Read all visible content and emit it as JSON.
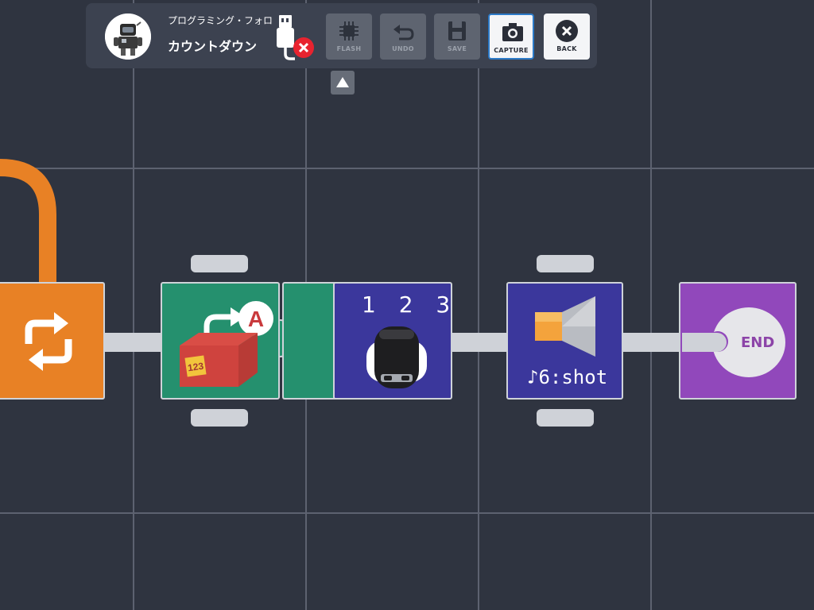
{
  "toolbar": {
    "subtitle": "プログラミング・フォロ",
    "title": "カウントダウン",
    "buttons": {
      "flash": "FLASH",
      "undo": "UNDO",
      "save": "SAVE",
      "capture": "CAPTURE",
      "back": "BACK"
    }
  },
  "blocks": {
    "number_display": {
      "label": "1 2 3"
    },
    "sound": {
      "label": "♪6:shot"
    },
    "end": {
      "label": "END"
    }
  },
  "colors": {
    "background": "#2f3440",
    "loop_block": "#e88125",
    "variable_block": "#25906e",
    "display_block": "#3b379c",
    "end_block": "#9148bb",
    "usb_error": "#e8232f",
    "selected_border": "#2c7ac8"
  },
  "icons": {
    "usb_status": "usb-disconnected-icon",
    "loop": "loop-arrows-icon",
    "variable": "variable-box-icon",
    "robot": "robot-head-icon",
    "sound": "speaker-icon"
  }
}
